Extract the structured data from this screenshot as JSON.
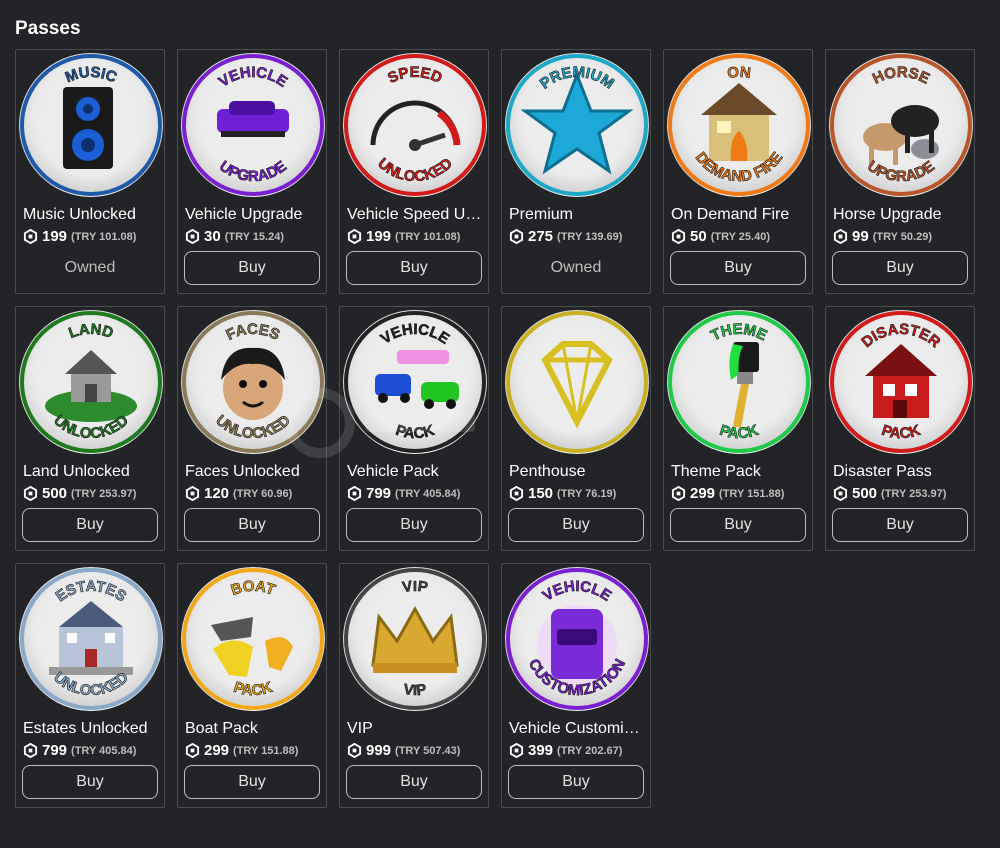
{
  "section": {
    "title": "Passes"
  },
  "passes": [
    {
      "name": "Music Unlocked",
      "robux": "199",
      "try": "(TRY 101.08)",
      "owned": true,
      "action": "Owned",
      "ring": "#1e5aa8",
      "top": "MUSIC",
      "bottom": "",
      "art": "speaker"
    },
    {
      "name": "Vehicle Upgrade",
      "robux": "30",
      "try": "(TRY 15.24)",
      "owned": false,
      "action": "Buy",
      "ring": "#7a1fd0",
      "top": "VEHICLE",
      "bottom": "UPGRADE",
      "art": "car-purple"
    },
    {
      "name": "Vehicle Speed Unlocked",
      "robux": "199",
      "try": "(TRY 101.08)",
      "owned": false,
      "action": "Buy",
      "ring": "#d11a1a",
      "top": "SPEED",
      "bottom": "UNLOCKED",
      "art": "gauge"
    },
    {
      "name": "Premium",
      "robux": "275",
      "try": "(TRY 139.69)",
      "owned": true,
      "action": "Owned",
      "ring": "#1ea8c8",
      "top": "PREMIUM",
      "bottom": "",
      "art": "star"
    },
    {
      "name": "On Demand Fire",
      "robux": "50",
      "try": "(TRY 25.40)",
      "owned": false,
      "action": "Buy",
      "ring": "#f07a16",
      "top": "ON",
      "bottom": "DEMAND FIRE",
      "art": "house-fire"
    },
    {
      "name": "Horse Upgrade",
      "robux": "99",
      "try": "(TRY 50.29)",
      "owned": false,
      "action": "Buy",
      "ring": "#b8552a",
      "top": "HORSE",
      "bottom": "UPGRADE",
      "art": "horses"
    },
    {
      "name": "Land Unlocked",
      "robux": "500",
      "try": "(TRY 253.97)",
      "owned": false,
      "action": "Buy",
      "ring": "#1f7a1f",
      "top": "LAND",
      "bottom": "UNLOCKED",
      "art": "land"
    },
    {
      "name": "Faces Unlocked",
      "robux": "120",
      "try": "(TRY 60.96)",
      "owned": false,
      "action": "Buy",
      "ring": "#8a7a5a",
      "top": "FACES",
      "bottom": "UNLOCKED",
      "art": "face"
    },
    {
      "name": "Vehicle Pack",
      "robux": "799",
      "try": "(TRY 405.84)",
      "owned": false,
      "action": "Buy",
      "ring": "#222222",
      "top": "VEHICLE",
      "bottom": "PACK",
      "art": "cars"
    },
    {
      "name": "Penthouse",
      "robux": "150",
      "try": "(TRY 76.19)",
      "owned": false,
      "action": "Buy",
      "ring": "#c9b021",
      "top": "",
      "bottom": "",
      "art": "diamond"
    },
    {
      "name": "Theme Pack",
      "robux": "299",
      "try": "(TRY 151.88)",
      "owned": false,
      "action": "Buy",
      "ring": "#1fc94a",
      "top": "THEME",
      "bottom": "PACK",
      "art": "brush"
    },
    {
      "name": "Disaster Pass",
      "robux": "500",
      "try": "(TRY 253.97)",
      "owned": false,
      "action": "Buy",
      "ring": "#d11a1a",
      "top": "DISASTER",
      "bottom": "PACK",
      "art": "house-red"
    },
    {
      "name": "Estates Unlocked",
      "robux": "799",
      "try": "(TRY 405.84)",
      "owned": false,
      "action": "Buy",
      "ring": "#8aa8c8",
      "top": "ESTATES",
      "bottom": "UNLOCKED",
      "art": "mansion"
    },
    {
      "name": "Boat Pack",
      "robux": "299",
      "try": "(TRY 151.88)",
      "owned": false,
      "action": "Buy",
      "ring": "#f0a818",
      "top": "BOAT",
      "bottom": "PACK",
      "art": "boats"
    },
    {
      "name": "VIP",
      "robux": "999",
      "try": "(TRY 507.43)",
      "owned": false,
      "action": "Buy",
      "ring": "#444444",
      "top": "VIP",
      "bottom": "VIP",
      "art": "crown"
    },
    {
      "name": "Vehicle Customization",
      "robux": "399",
      "try": "(TRY 202.67)",
      "owned": false,
      "action": "Buy",
      "ring": "#7a1fd0",
      "top": "VEHICLE",
      "bottom": "CUSTOMIZATION",
      "art": "car-front"
    }
  ]
}
